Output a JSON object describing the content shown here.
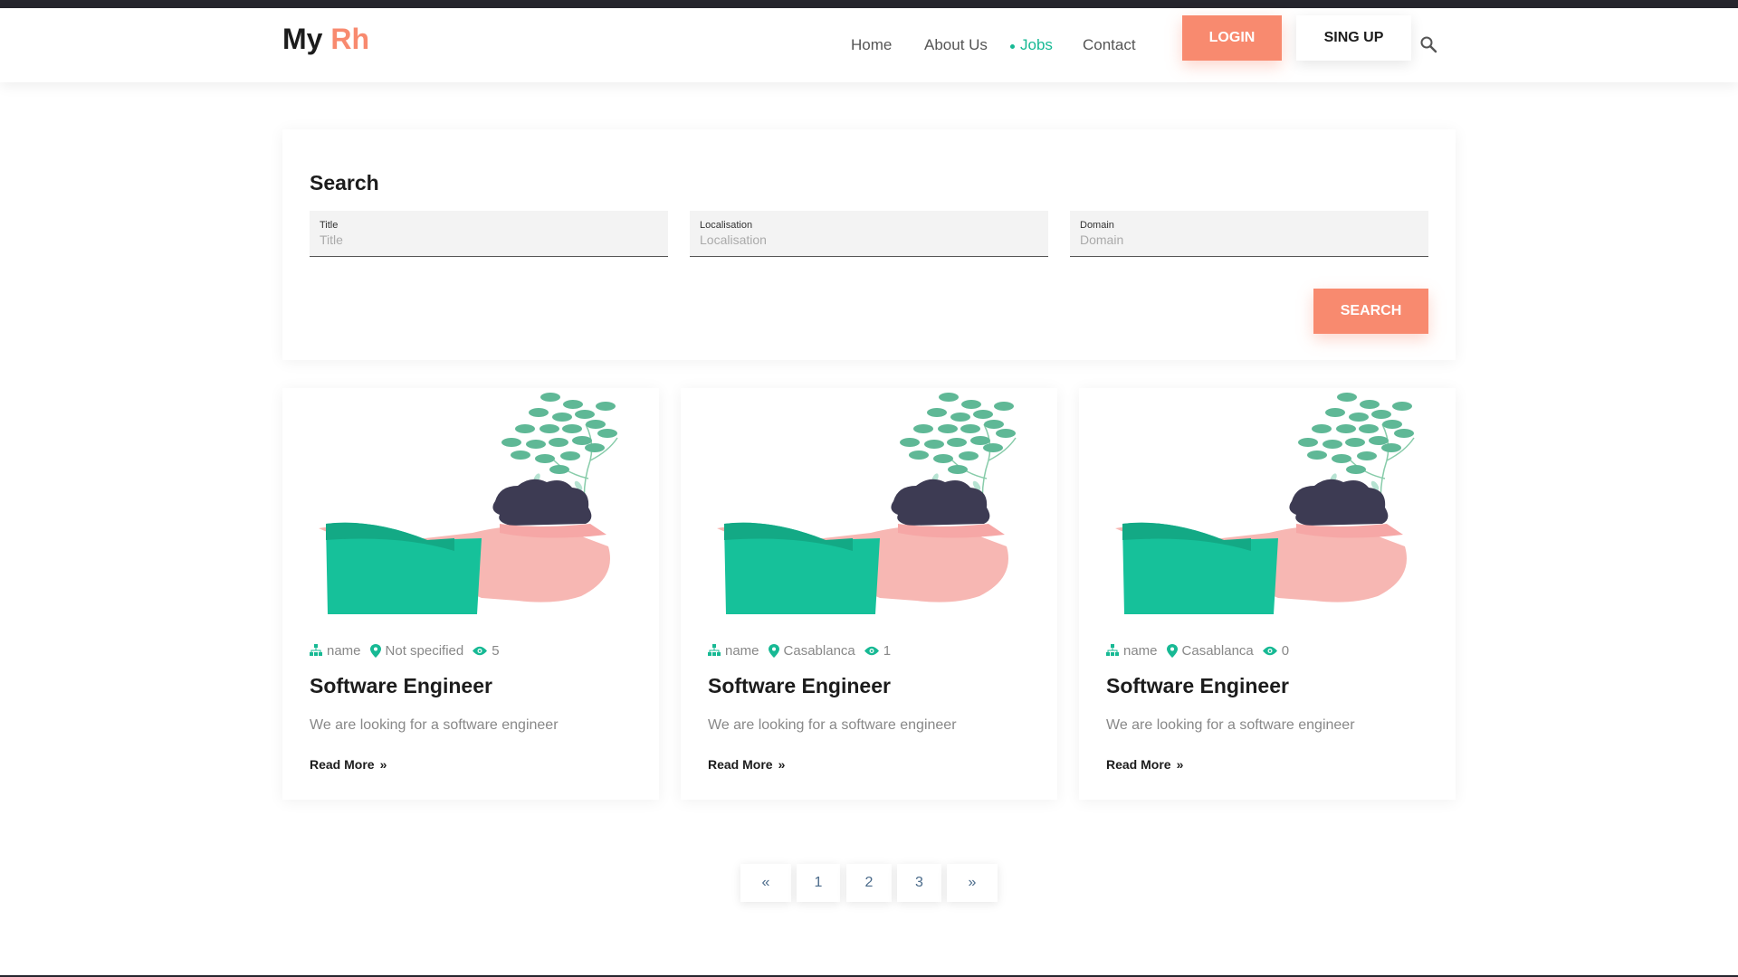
{
  "brand": {
    "prefix": "My",
    "accent": "Rh",
    "accent_color": "#f88a6f"
  },
  "nav": {
    "items": [
      {
        "label": "Home"
      },
      {
        "label": "About Us"
      },
      {
        "label": "Jobs",
        "active": true
      },
      {
        "label": "Contact"
      }
    ],
    "active_color": "#17b994"
  },
  "header_actions": {
    "login_label": "LOGIN",
    "signup_label": "SING UP",
    "search_icon": "magnifier-icon"
  },
  "search": {
    "title": "Search",
    "fields": [
      {
        "label": "Title",
        "placeholder": "Title",
        "value": ""
      },
      {
        "label": "Localisation",
        "placeholder": "Localisation",
        "value": ""
      },
      {
        "label": "Domain",
        "placeholder": "Domain",
        "value": ""
      }
    ],
    "button_label": "SEARCH"
  },
  "jobs": [
    {
      "company": "name",
      "location": "Not specified",
      "views": "5",
      "title": "Software Engineer",
      "description": "We are looking for a software engineer",
      "read_more": "Read More"
    },
    {
      "company": "name",
      "location": "Casablanca",
      "views": "1",
      "title": "Software Engineer",
      "description": "We are looking for a software engineer",
      "read_more": "Read More"
    },
    {
      "company": "name",
      "location": "Casablanca",
      "views": "0",
      "title": "Software Engineer",
      "description": "We are looking for a software engineer",
      "read_more": "Read More"
    }
  ],
  "pagination": {
    "prev": "«",
    "pages": [
      "1",
      "2",
      "3"
    ],
    "next": "»"
  },
  "colors": {
    "accent": "#f88a6f",
    "green": "#17b994",
    "dark": "#26262e"
  }
}
